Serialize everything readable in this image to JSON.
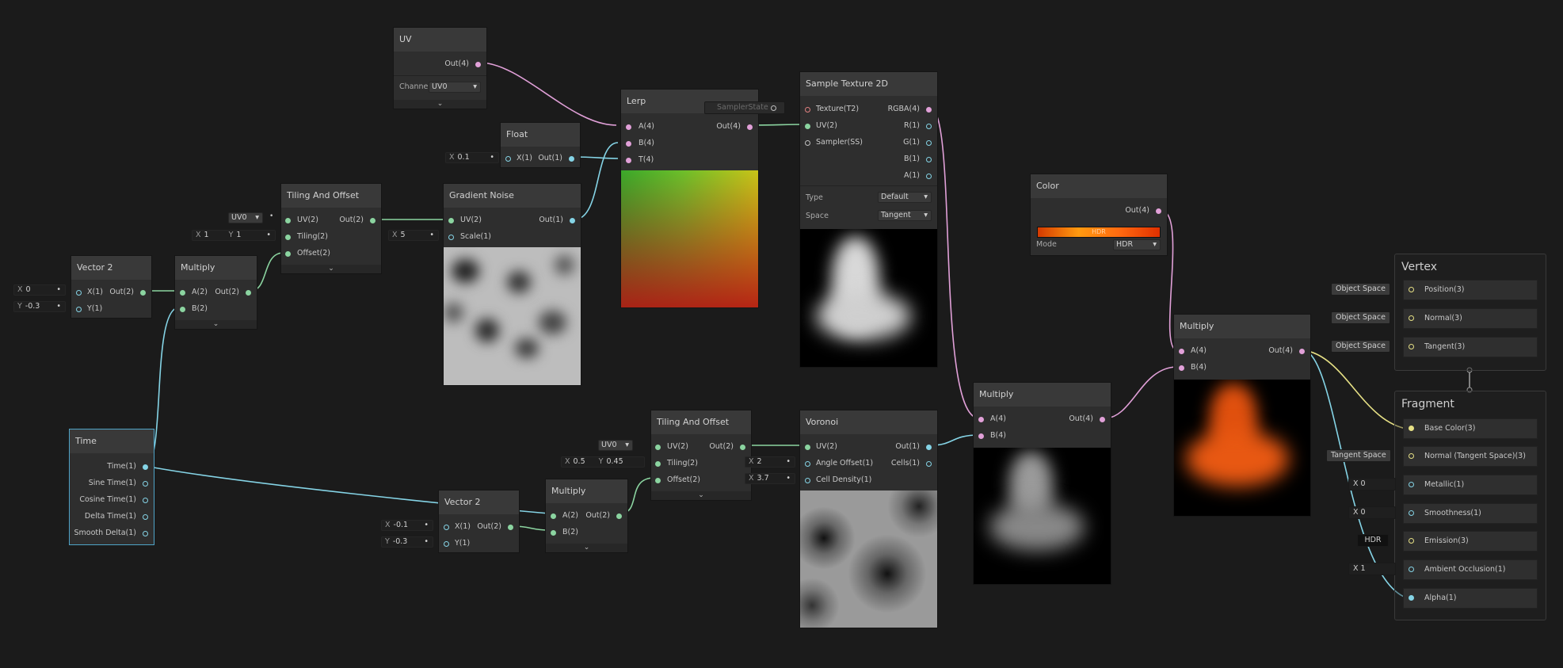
{
  "nodes": {
    "uv": {
      "title": "UV",
      "out": "Out(4)",
      "channel_label": "Channel",
      "channel_value": "UV0",
      "expand": "⌄"
    },
    "float": {
      "title": "Float",
      "x_label": "X",
      "x_value": "0.1",
      "in": "X(1)",
      "out": "Out(1)"
    },
    "lerp": {
      "title": "Lerp",
      "in_a": "A(4)",
      "in_b": "B(4)",
      "in_t": "T(4)",
      "out": "Out(4)"
    },
    "sample_texture": {
      "title": "Sample Texture 2D",
      "in_texture": "Texture(T2)",
      "in_uv": "UV(2)",
      "in_sampler": "Sampler(SS)",
      "out_rgba": "RGBA(4)",
      "out_r": "R(1)",
      "out_g": "G(1)",
      "out_b": "B(1)",
      "out_a": "A(1)",
      "type_label": "Type",
      "type_value": "Default",
      "space_label": "Space",
      "space_value": "Tangent",
      "sampler_chip": "SamplerState"
    },
    "color": {
      "title": "Color",
      "out": "Out(4)",
      "hdr_badge": "HDR",
      "mode_label": "Mode",
      "mode_value": "HDR",
      "swatch": "#ff6a10"
    },
    "tiling1": {
      "title": "Tiling And Offset",
      "in_uv": "UV(2)",
      "in_tiling": "Tiling(2)",
      "in_offset": "Offset(2)",
      "out": "Out(2)",
      "uv_field": "UV0",
      "tx_label": "X",
      "tx": "1",
      "ty_label": "Y",
      "ty": "1",
      "expand": "⌄"
    },
    "gradient_noise": {
      "title": "Gradient Noise",
      "in_uv": "UV(2)",
      "in_scale": "Scale(1)",
      "out": "Out(1)",
      "scale_label": "X",
      "scale_value": "5"
    },
    "vec2a": {
      "title": "Vector 2",
      "in_x": "X(1)",
      "in_y": "Y(1)",
      "out": "Out(2)",
      "x_label": "X",
      "x_value": "0",
      "y_label": "Y",
      "y_value": "-0.3"
    },
    "mult1": {
      "title": "Multiply",
      "in_a": "A(2)",
      "in_b": "B(2)",
      "out": "Out(2)",
      "expand": "⌄"
    },
    "time": {
      "title": "Time",
      "outs": [
        "Time(1)",
        "Sine Time(1)",
        "Cosine Time(1)",
        "Delta Time(1)",
        "Smooth Delta(1)"
      ]
    },
    "vec2b": {
      "title": "Vector 2",
      "in_x": "X(1)",
      "in_y": "Y(1)",
      "out": "Out(2)",
      "x_label": "X",
      "x_value": "-0.1",
      "y_label": "Y",
      "y_value": "-0.3"
    },
    "mult2": {
      "title": "Multiply",
      "in_a": "A(2)",
      "in_b": "B(2)",
      "out": "Out(2)",
      "expand": "⌄"
    },
    "tiling2": {
      "title": "Tiling And Offset",
      "in_uv": "UV(2)",
      "in_tiling": "Tiling(2)",
      "in_offset": "Offset(2)",
      "out": "Out(2)",
      "uv_field": "UV0",
      "tx_label": "X",
      "tx": "0.5",
      "ty_label": "Y",
      "ty": "0.45",
      "expand": "⌄"
    },
    "voronoi": {
      "title": "Voronoi",
      "in_uv": "UV(2)",
      "in_angle": "Angle Offset(1)",
      "in_density": "Cell Density(1)",
      "out": "Out(1)",
      "out_cells": "Cells(1)",
      "angle_label": "X",
      "angle_value": "2",
      "density_label": "X",
      "density_value": "3.7"
    },
    "mult3": {
      "title": "Multiply",
      "in_a": "A(4)",
      "in_b": "B(4)",
      "out": "Out(4)"
    },
    "mult4": {
      "title": "Multiply",
      "in_a": "A(4)",
      "in_b": "B(4)",
      "out": "Out(4)"
    }
  },
  "master": {
    "vertex": {
      "title": "Vertex",
      "slots": [
        {
          "label": "Position(3)",
          "chip": "Object Space"
        },
        {
          "label": "Normal(3)",
          "chip": "Object Space"
        },
        {
          "label": "Tangent(3)",
          "chip": "Object Space"
        }
      ]
    },
    "fragment": {
      "title": "Fragment",
      "slots": [
        {
          "label": "Base Color(3)",
          "chip": ""
        },
        {
          "label": "Normal (Tangent Space)(3)",
          "chip": "Tangent Space"
        },
        {
          "label": "Metallic(1)",
          "chip": "X  0"
        },
        {
          "label": "Smoothness(1)",
          "chip": "X  0"
        },
        {
          "label": "Emission(3)",
          "chip": "HDR"
        },
        {
          "label": "Ambient Occlusion(1)",
          "chip": "X  1"
        },
        {
          "label": "Alpha(1)",
          "chip": ""
        }
      ]
    }
  },
  "colors": {
    "background": "#1b1b1b",
    "selection": "#4fa3c7",
    "vec4_port": "#e1a0d8",
    "vec2_port": "#8bd4a0",
    "vec1_port": "#85d4e6",
    "vec3_port": "#e6e085"
  }
}
